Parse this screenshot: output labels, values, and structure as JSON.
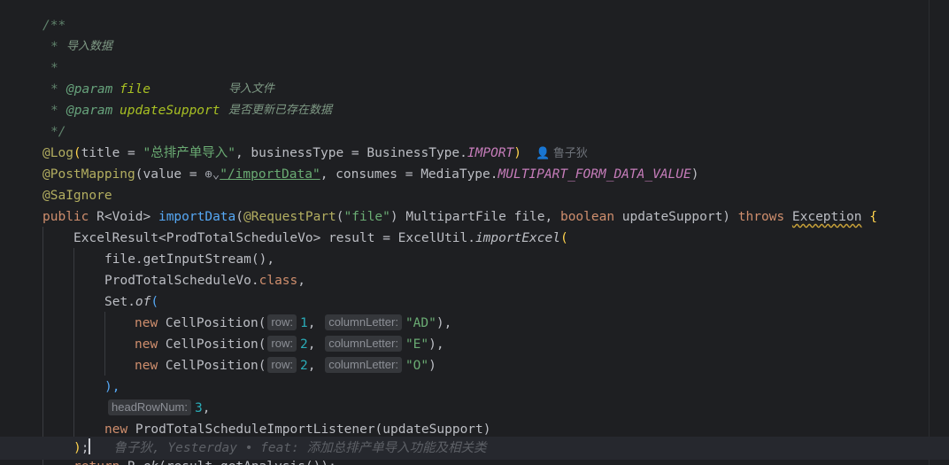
{
  "doc": {
    "open": "/**",
    "star": "*",
    "summary": "导入数据",
    "tag": "@param",
    "param1": "file",
    "param1_desc": "导入文件",
    "param2": "updateSupport",
    "param2_desc": "是否更新已存在数据",
    "close": "*/"
  },
  "annotations": {
    "log": "@Log",
    "log_title_key": "title = ",
    "log_title_val": "\"总排产单导入\"",
    "log_bt": ", businessType = BusinessType.",
    "log_import": "IMPORT",
    "author": "鲁子狄",
    "post": "@PostMapping",
    "post_value": "(value = ",
    "globe": "⊕⌄",
    "post_path": "\"/importData\"",
    "post_consumes": ", consumes = MediaType.",
    "post_media": "MULTIPART_FORM_DATA_VALUE",
    "sa": "@SaIgnore"
  },
  "signature": {
    "public": "public",
    "ret": " R<Void> ",
    "name": "importData",
    "reqpart": "@RequestPart",
    "reqpart_val": "\"file\"",
    "rest": " MultipartFile file, ",
    "boolean": "boolean",
    "rest2": " updateSupport) ",
    "throws": "throws",
    "exception": "Exception",
    "brace": " {"
  },
  "body": {
    "l1_a": "ExcelResult<ProdTotalScheduleVo> result = ExcelUtil.",
    "l1_fn": "importExcel",
    "l2_a": "file.",
    "l2_fn": "getInputStream",
    "l2_b": "(),",
    "l3_a": "ProdTotalScheduleVo.",
    "l3_kw": "class",
    "l3_b": ",",
    "l4_a": "Set.",
    "l4_fn": "of",
    "new": "new",
    "cell": " CellPosition(",
    "hint_row": "row:",
    "hint_col": "columnLetter:",
    "r1_row": "1",
    "r1_col": "\"AD\"",
    "r1_end": "),",
    "r2_row": "2",
    "r2_col": "\"E\"",
    "r2_end": "),",
    "r3_row": "2",
    "r3_col": "\"O\"",
    "r3_end": ")",
    "close_set": "),",
    "hint_head": "headRowNum:",
    "head_val": "3",
    "listener_a": " ProdTotalScheduleImportListener(updateSupport)",
    "close_call": ");",
    "blame": "鲁子狄, Yesterday • feat: 添加总排产单导入功能及相关类",
    "ret_line": "return R.ok(result.getAnalysis());"
  }
}
